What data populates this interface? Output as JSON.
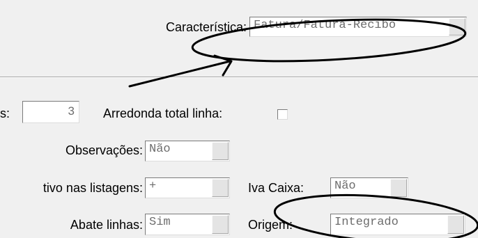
{
  "caracteristica": {
    "label": "Característica:",
    "value": "Fatura/Fatura-Recibo"
  },
  "casas": {
    "label_fragment": "s:",
    "value": "3"
  },
  "arredonda": {
    "label": "Arredonda total linha:"
  },
  "observacoes": {
    "label": "Observações:",
    "value": "Não"
  },
  "listagens": {
    "label": "tivo nas listagens:",
    "value": "+"
  },
  "iva_caixa": {
    "label": "Iva Caixa:",
    "value": "Não"
  },
  "abate": {
    "label": "Abate linhas:",
    "value": "Sim"
  },
  "origem": {
    "label": "Origem:",
    "value": "Integrado"
  },
  "annotation_color": "#000000"
}
